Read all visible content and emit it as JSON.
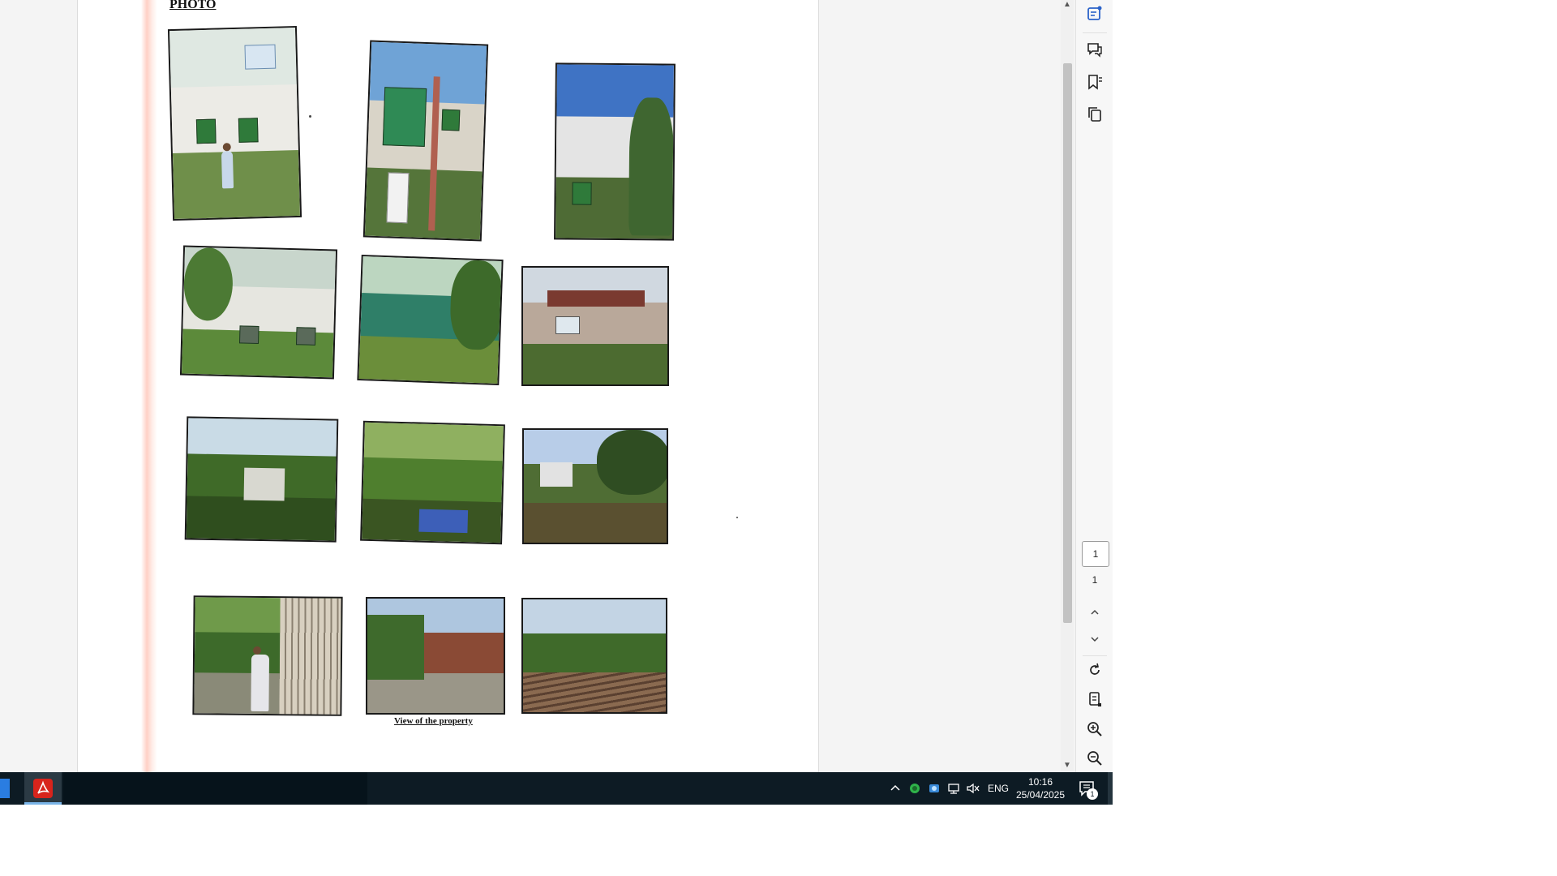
{
  "document": {
    "heading": "PHOTO",
    "caption": "View of the property"
  },
  "photos": [
    {
      "scene": "building-with-man",
      "colors": {
        "sky": "#dfe8e2",
        "mid": "#e8e8e4",
        "ground": "#6f8f4a"
      }
    },
    {
      "scene": "building-front-glass",
      "colors": {
        "sky": "#6fa3d6",
        "mid": "#d9d4c8",
        "ground": "#55753a"
      }
    },
    {
      "scene": "building-side",
      "colors": {
        "sky": "#3f73c4",
        "mid": "#e4e4e4",
        "ground": "#4e6b35"
      }
    },
    {
      "scene": "overgrown-building",
      "colors": {
        "sky": "#c8d6cc",
        "mid": "#e6e6e0",
        "ground": "#5c8a3a"
      }
    },
    {
      "scene": "green-net-enclosure",
      "colors": {
        "sky": "#bcd6c0",
        "mid": "#2f7f68",
        "ground": "#6b8e3a"
      }
    },
    {
      "scene": "old-house",
      "colors": {
        "sky": "#d0d8e0",
        "mid": "#b9a89a",
        "ground": "#4c6b30"
      }
    },
    {
      "scene": "garden-trees",
      "colors": {
        "sky": "#c9dbe6",
        "mid": "#3f6a28",
        "ground": "#2f4e1e"
      }
    },
    {
      "scene": "dense-vegetation",
      "colors": {
        "sky": "#8fb060",
        "mid": "#4f7f2e",
        "ground": "#3a5522"
      }
    },
    {
      "scene": "distant-house",
      "colors": {
        "sky": "#b8cde8",
        "mid": "#4f6d34",
        "ground": "#5a5030"
      }
    },
    {
      "scene": "man-at-gate",
      "colors": {
        "sky": "#6f9a4a",
        "mid": "#3d6a2a",
        "ground": "#8a8a78"
      }
    },
    {
      "scene": "brick-wall-lane",
      "colors": {
        "sky": "#aec6df",
        "mid": "#8a4a35",
        "ground": "#9a9688"
      }
    },
    {
      "scene": "plank-path",
      "colors": {
        "sky": "#c3d4e4",
        "mid": "#3f6a2a",
        "ground": "#7a6048"
      }
    }
  ],
  "toolbar": {
    "page_current": "1",
    "page_total": "1"
  },
  "taskbar": {
    "language": "ENG",
    "time": "10:16",
    "date": "25/04/2025",
    "notification_count": "1"
  }
}
